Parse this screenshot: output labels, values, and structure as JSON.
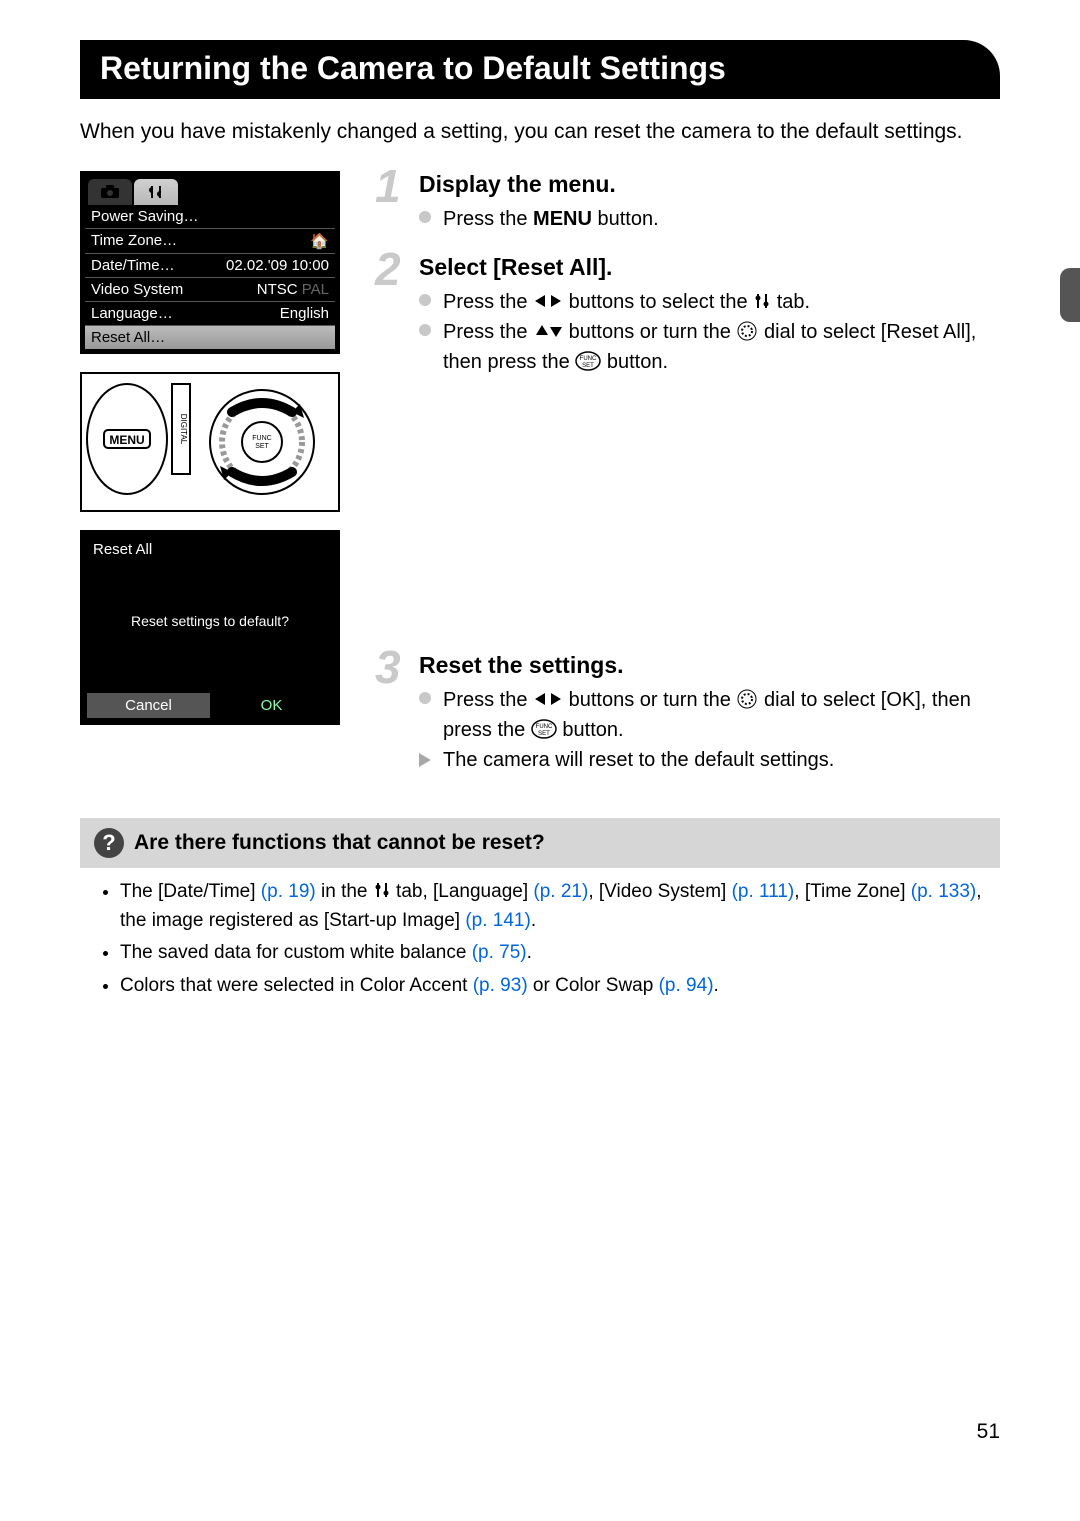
{
  "title": "Returning the Camera to Default Settings",
  "intro": "When you have mistakenly changed a setting, you can reset the camera to the default settings.",
  "menu": {
    "rows": [
      {
        "label": "Power Saving…",
        "value": ""
      },
      {
        "label": "Time Zone…",
        "value": "⌂"
      },
      {
        "label": "Date/Time…",
        "value": "02.02.'09 10:00"
      },
      {
        "label": "Video System",
        "value": "NTSC",
        "value2": "PAL"
      },
      {
        "label": "Language…",
        "value": "English"
      },
      {
        "label": "Reset All…",
        "value": ""
      }
    ]
  },
  "dialog": {
    "title": "Reset All",
    "prompt": "Reset settings to default?",
    "cancel": "Cancel",
    "ok": "OK"
  },
  "steps": [
    {
      "num": "1",
      "title": "Display the menu.",
      "lines": [
        {
          "type": "dot",
          "parts": [
            "Press the ",
            "MENU",
            " button."
          ]
        }
      ]
    },
    {
      "num": "2",
      "title": "Select [Reset All].",
      "lines": [
        {
          "type": "dot",
          "parts": [
            "Press the ",
            "LR",
            " buttons to select the ",
            "TOOLS",
            " tab."
          ]
        },
        {
          "type": "dot",
          "parts": [
            "Press the ",
            "UD",
            " buttons or turn the ",
            "DIAL",
            " dial to select [Reset All], then press the ",
            "FUNC",
            " button."
          ]
        }
      ]
    },
    {
      "num": "3",
      "title": "Reset the settings.",
      "lines": [
        {
          "type": "dot",
          "parts": [
            "Press the ",
            "LR",
            " buttons or turn the ",
            "DIAL",
            " dial to select [OK], then press the ",
            "FUNC",
            " button."
          ]
        },
        {
          "type": "tri",
          "parts": [
            "The camera will reset to the default settings."
          ]
        }
      ]
    }
  ],
  "qa": {
    "title": "Are there functions that cannot be reset?",
    "notes": [
      [
        {
          "t": "The [Date/Time] "
        },
        {
          "p": "(p. 19)"
        },
        {
          "t": " in the "
        },
        {
          "icon": "TOOLS"
        },
        {
          "t": " tab, [Language] "
        },
        {
          "p": "(p. 21)"
        },
        {
          "t": ", [Video System] "
        },
        {
          "p": "(p. 111)"
        },
        {
          "t": ", [Time Zone] "
        },
        {
          "p": "(p. 133)"
        },
        {
          "t": ", the image registered as [Start-up Image] "
        },
        {
          "p": "(p. 141)"
        },
        {
          "t": "."
        }
      ],
      [
        {
          "t": "The saved data for custom white balance "
        },
        {
          "p": "(p. 75)"
        },
        {
          "t": "."
        }
      ],
      [
        {
          "t": "Colors that were selected in Color Accent "
        },
        {
          "p": "(p. 93)"
        },
        {
          "t": " or Color Swap "
        },
        {
          "p": "(p. 94)"
        },
        {
          "t": "."
        }
      ]
    ]
  },
  "page_num": "51"
}
